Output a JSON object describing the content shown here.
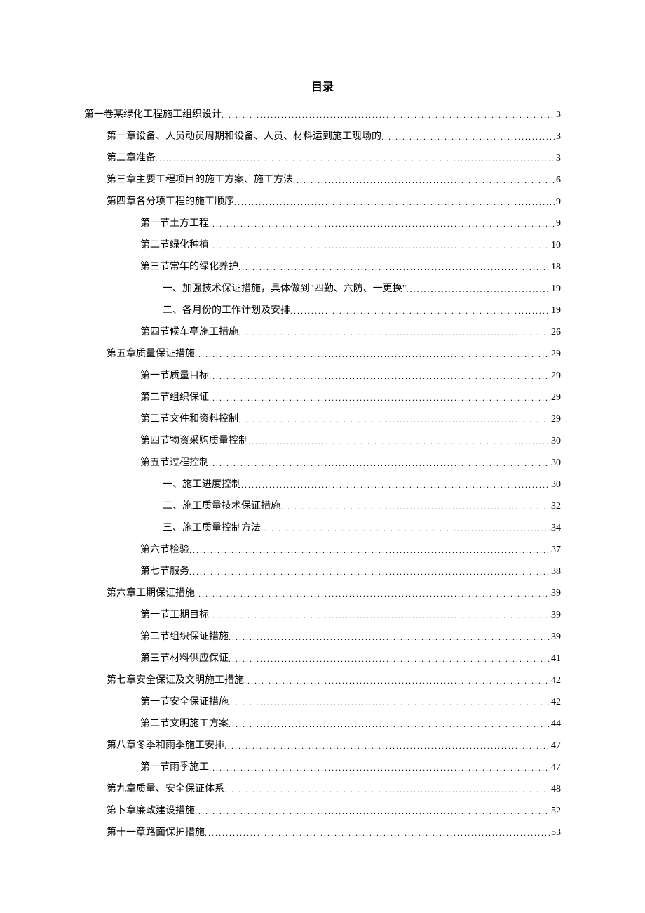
{
  "title": "目录",
  "toc": [
    {
      "level": 0,
      "text": "第一卷某绿化工程施工组织设计",
      "page": "3"
    },
    {
      "level": 1,
      "text": "第一章设备、人员动员周期和设备、人员、材料运到施工现场的",
      "page": "3"
    },
    {
      "level": 1,
      "text": "第二章准备",
      "page": "3"
    },
    {
      "level": 1,
      "text": "第三章主要工程项目的施工方案、施工方法",
      "page": "6"
    },
    {
      "level": 1,
      "text": "第四章各分项工程的施工顺序",
      "page": "9"
    },
    {
      "level": 2,
      "text": "第一节土方工程",
      "page": "9"
    },
    {
      "level": 2,
      "text": "第二节绿化种植",
      "page": "10"
    },
    {
      "level": 2,
      "text": "第三节常年的绿化养护",
      "page": "18"
    },
    {
      "level": 3,
      "text": "一、加强技术保证措施，具体做到\"四勤、六防、一更换\"",
      "page": "19"
    },
    {
      "level": 3,
      "text": "二、各月份的工作计划及安排",
      "page": "19"
    },
    {
      "level": 2,
      "text": "第四节候车亭施工措施",
      "page": "26"
    },
    {
      "level": 1,
      "text": "第五章质量保证措施",
      "page": "29"
    },
    {
      "level": 2,
      "text": "第一节质量目标",
      "page": "29"
    },
    {
      "level": 2,
      "text": "第二节组织保证",
      "page": "29"
    },
    {
      "level": 2,
      "text": "第三节文件和资料控制",
      "page": "29"
    },
    {
      "level": 2,
      "text": "第四节物资采购质量控制",
      "page": "30"
    },
    {
      "level": 2,
      "text": "第五节过程控制",
      "page": "30"
    },
    {
      "level": 3,
      "text": "一、施工进度控制",
      "page": "30"
    },
    {
      "level": 3,
      "text": "二、施工质量技术保证措施",
      "page": "32"
    },
    {
      "level": 3,
      "text": "三、施工质量控制方法",
      "page": "34"
    },
    {
      "level": 2,
      "text": "第六节检验",
      "page": "37"
    },
    {
      "level": 2,
      "text": "第七节服务",
      "page": "38"
    },
    {
      "level": 1,
      "text": "第六章工期保证措施",
      "page": "39"
    },
    {
      "level": 2,
      "text": "第一节工期目标",
      "page": "39"
    },
    {
      "level": 2,
      "text": "第二节组织保证措施",
      "page": "39"
    },
    {
      "level": 2,
      "text": "第三节材料供应保证",
      "page": "41"
    },
    {
      "level": 1,
      "text": "第七章安全保证及文明施工措施",
      "page": "42"
    },
    {
      "level": 2,
      "text": "第一节安全保证措施",
      "page": "42"
    },
    {
      "level": 2,
      "text": "第二节文明施工方案",
      "page": "44"
    },
    {
      "level": 1,
      "text": "第八章冬季和雨季施工安排",
      "page": "47"
    },
    {
      "level": 2,
      "text": "第一节雨季施工",
      "page": "47"
    },
    {
      "level": 1,
      "text": "第九章质量、安全保证体系",
      "page": "48"
    },
    {
      "level": 1,
      "text": "第卜章廉政建设措施",
      "page": "52"
    },
    {
      "level": 1,
      "text": "第十一章路面保护措施",
      "page": "53"
    }
  ]
}
